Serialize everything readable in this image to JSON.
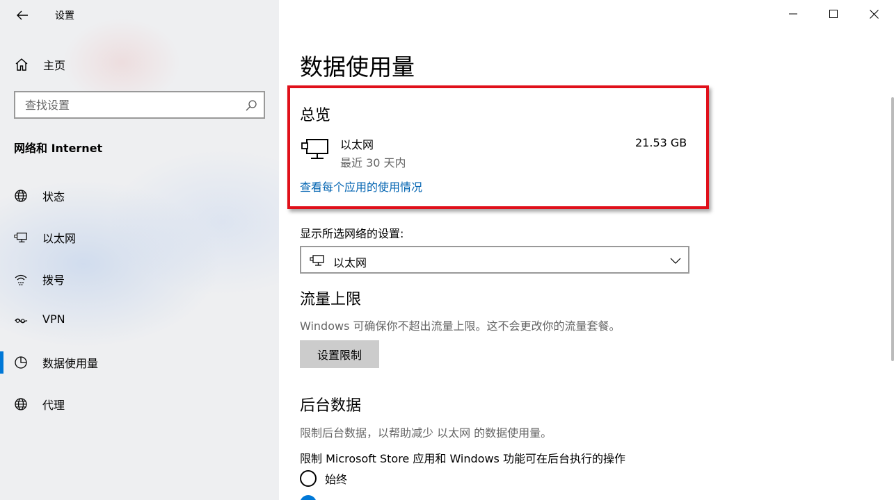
{
  "window": {
    "app_title": "设置",
    "controls": [
      "minimize",
      "maximize",
      "close"
    ]
  },
  "sidebar": {
    "home_label": "主页",
    "search": {
      "placeholder": "查找设置"
    },
    "section_label": "网络和 Internet",
    "items": [
      {
        "label": "状态",
        "icon": "globe-status-icon"
      },
      {
        "label": "以太网",
        "icon": "ethernet-icon"
      },
      {
        "label": "拨号",
        "icon": "dialup-icon"
      },
      {
        "label": "VPN",
        "icon": "vpn-icon"
      },
      {
        "label": "数据使用量",
        "icon": "data-usage-icon",
        "active": true
      },
      {
        "label": "代理",
        "icon": "globe-proxy-icon"
      }
    ]
  },
  "main": {
    "page_title": "数据使用量",
    "overview": {
      "heading": "总览",
      "network_name": "以太网",
      "period": "最近 30 天内",
      "usage": "21.53 GB",
      "link": "查看每个应用的使用情况"
    },
    "network_select": {
      "label": "显示所选网络的设置:",
      "value": "以太网"
    },
    "limit": {
      "heading": "流量上限",
      "description": "Windows 可确保你不超出流量上限。这不会更改你的流量套餐。",
      "button": "设置限制"
    },
    "background": {
      "heading": "后台数据",
      "description": "限制后台数据，以帮助减少 以太网 的数据使用量。",
      "restrict_label": "限制 Microsoft Store 应用和 Windows 功能可在后台执行的操作",
      "option_always": "始终"
    }
  },
  "colors": {
    "accent": "#0078d7",
    "link": "#0063b1",
    "highlight_border": "#e0101a"
  }
}
